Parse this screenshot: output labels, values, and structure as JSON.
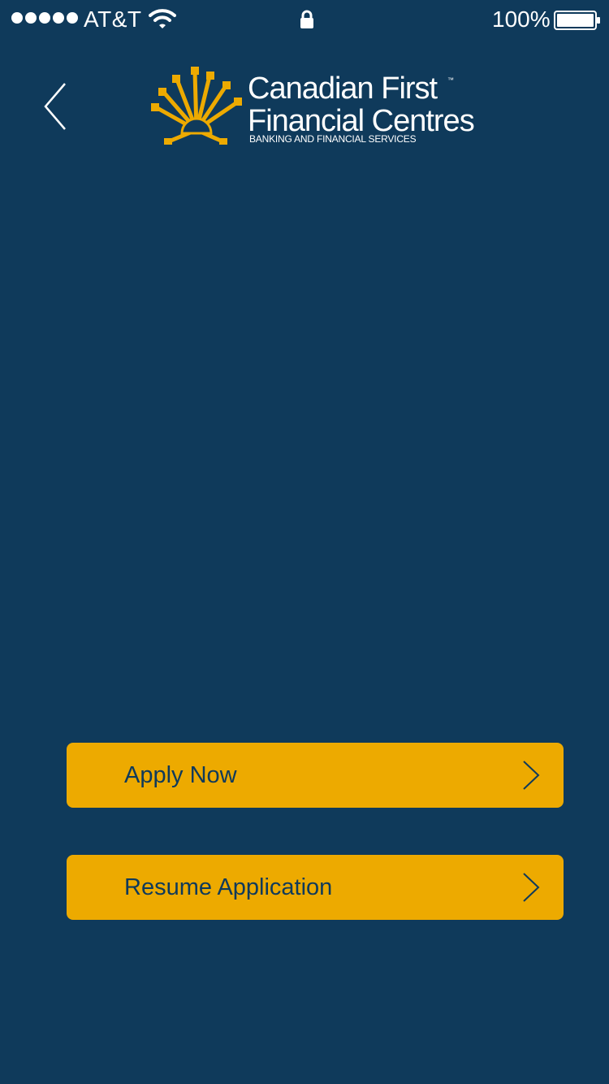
{
  "status_bar": {
    "carrier": "AT&T",
    "signal_bars": 5,
    "battery_percent": "100%",
    "icons": [
      "signal-dots-icon",
      "wifi-icon",
      "lock-icon",
      "battery-icon"
    ]
  },
  "header": {
    "back_icon": "chevron-left-icon",
    "logo": {
      "name_line1": "Canadian First",
      "name_line2": "Financial Centres",
      "trademark": "™",
      "tagline": "BANKING AND FINANCIAL SERVICES"
    }
  },
  "actions": [
    {
      "label": "Apply Now",
      "icon": "chevron-right-icon"
    },
    {
      "label": "Resume Application",
      "icon": "chevron-right-icon"
    }
  ],
  "colors": {
    "background": "#0f3a5b",
    "button": "#edaa00",
    "button_text": "#0f3a5b",
    "logo_gold": "#edaa00",
    "text": "#ffffff"
  }
}
